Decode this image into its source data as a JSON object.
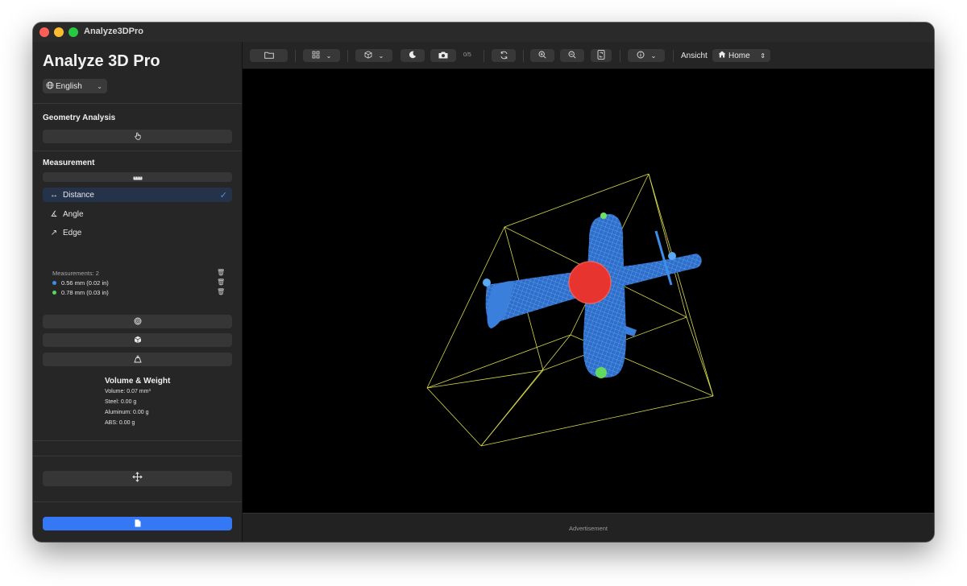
{
  "window": {
    "title": "Analyze3DPro"
  },
  "sidebar": {
    "app_title": "Analyze 3D Pro",
    "language": "English",
    "geometry_section": "Geometry Analysis",
    "measurement_section": "Measurement",
    "modes": [
      {
        "label": "Distance",
        "icon": "double-arrow-icon",
        "selected": true
      },
      {
        "label": "Angle",
        "icon": "angle-icon",
        "selected": false
      },
      {
        "label": "Edge",
        "icon": "diagonal-arrow-icon",
        "selected": false
      }
    ],
    "measurements_count": "Measurements: 2",
    "measurements": [
      {
        "value": "0.56 mm (0.02 in)",
        "color": "#3b8fe8"
      },
      {
        "value": "0.78 mm (0.03 in)",
        "color": "#56d65c"
      }
    ],
    "volume": {
      "title": "Volume & Weight",
      "volume": "Volume: 0.07 mm³",
      "steel": "Steel: 0.00 g",
      "aluminum": "Aluminum: 0.00 g",
      "abs": "ABS: 0.00 g"
    },
    "accent_color": "#3478f6"
  },
  "toolbar": {
    "screenshot_count": "0/5",
    "view_label": "Ansicht",
    "view_select": "Home"
  },
  "viewport": {
    "model_color": "#3b8fe8",
    "bounding_box_color": "#d8d84a"
  },
  "footer": {
    "ad_label": "Advertisement"
  }
}
